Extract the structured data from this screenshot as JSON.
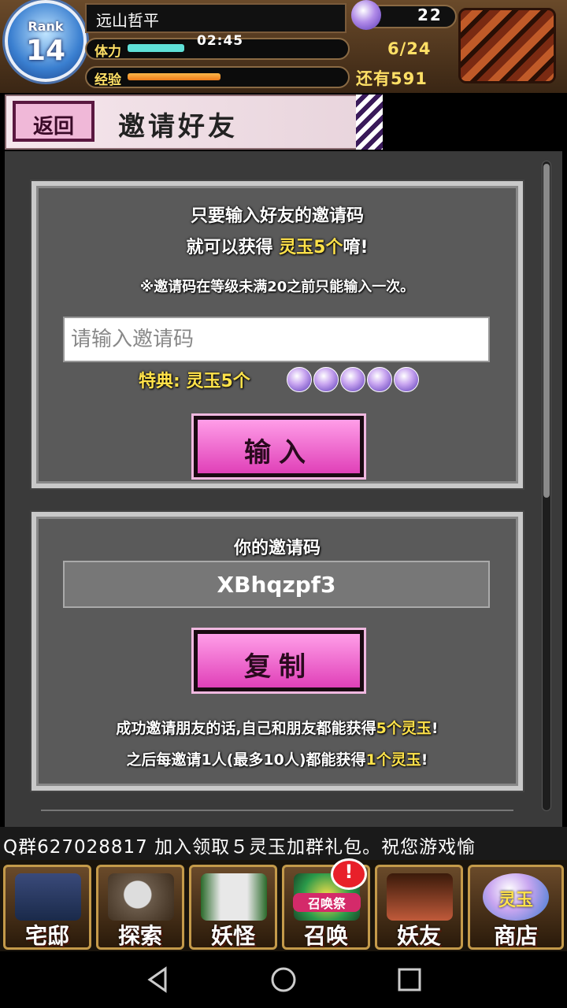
{
  "header": {
    "rank_label": "Rank",
    "rank_value": "14",
    "player_name": "远山哲平",
    "stamina_label": "体力",
    "stamina_timer": "02:45",
    "stamina_count": "6/24",
    "stamina_fraction": 0.25,
    "exp_label": "经验",
    "exp_remaining": "还有591",
    "exp_fraction": 0.4,
    "gem_count": "22"
  },
  "banner": {
    "back_label": "返回",
    "title": "邀请好友"
  },
  "invite_panel": {
    "intro_line1": "只要输入好友的邀请码",
    "intro_line2_pre": "就可以获得",
    "intro_line2_highlight": "灵玉5个",
    "intro_line2_post": "唷!",
    "note": "※邀请码在等级未满20之前只能输入一次。",
    "input_placeholder": "请输入邀请码",
    "bonus_label": "特典:",
    "bonus_value": "灵玉5个",
    "gem_icon_count": 5,
    "input_button": "输入"
  },
  "my_code_panel": {
    "label": "你的邀请码",
    "code": "XBhqzpf3",
    "copy_button": "复制",
    "reward_line1_pre": "成功邀请朋友的话,自己和朋友都能获得",
    "reward_line1_highlight": "5个灵玉",
    "reward_line1_post": "!",
    "reward_line2_pre": "之后每邀请1人(最多10人)都能获得",
    "reward_line2_highlight": "1个灵玉",
    "reward_line2_post": "!"
  },
  "ticker": {
    "text": "Q群627028817  加入领取５灵玉加群礼包。祝您游戏愉"
  },
  "bottom_nav": [
    {
      "label": "宅邸",
      "icon": "mansion-icon"
    },
    {
      "label": "探索",
      "icon": "magnifier-icon"
    },
    {
      "label": "妖怪",
      "icon": "scroll-icon"
    },
    {
      "label": "召唤",
      "icon": "summon-icon"
    },
    {
      "label": "妖友",
      "icon": "fox-girl-icon"
    },
    {
      "label": "商店",
      "icon": "gem-orb-icon"
    }
  ],
  "summon_badge": "!",
  "summon_tag": "召唤祭",
  "shop_icon_text": "灵玉",
  "colors": {
    "accent_pink": "#e040b8",
    "highlight_yellow": "#ffe24a",
    "panel_gray": "#5a5a5a"
  }
}
